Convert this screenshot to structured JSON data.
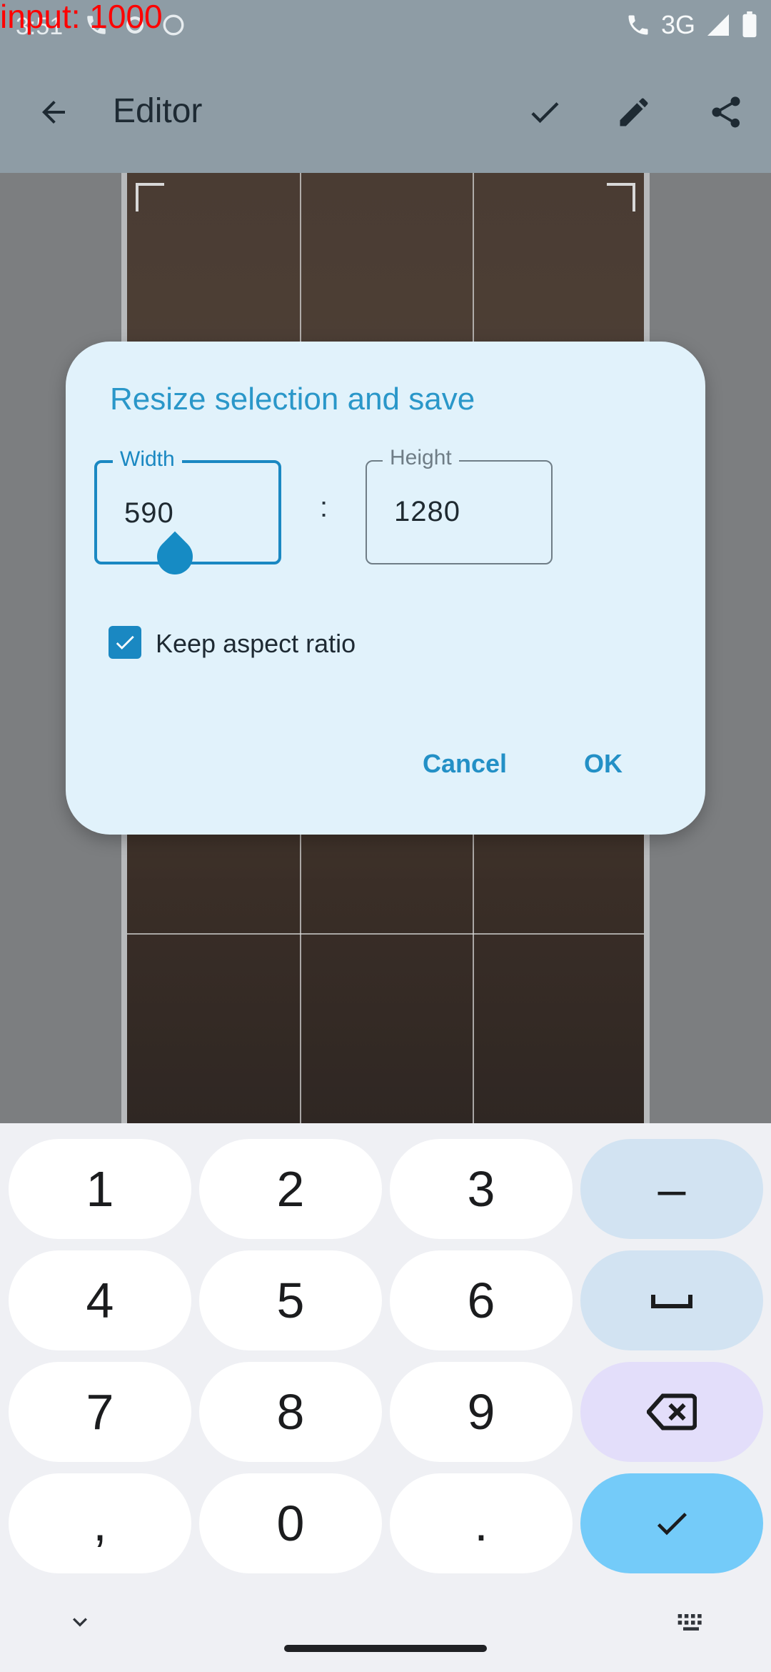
{
  "debug": {
    "input_text": "input: 1000"
  },
  "status": {
    "time": "3:51",
    "network": "3G"
  },
  "app_bar": {
    "title": "Editor",
    "back_icon": "back-arrow-icon",
    "confirm_icon": "check-icon",
    "edit_icon": "pencil-icon",
    "share_icon": "share-icon"
  },
  "dialog": {
    "title": "Resize selection and save",
    "width_label": "Width",
    "width_value": "590",
    "height_label": "Height",
    "height_value": "1280",
    "separator": ":",
    "keep_aspect_ratio_label": "Keep aspect ratio",
    "keep_aspect_ratio_checked": true,
    "cancel_label": "Cancel",
    "ok_label": "OK"
  },
  "keyboard": {
    "keys": [
      "1",
      "2",
      "3",
      "–",
      "4",
      "5",
      "6",
      "space",
      "7",
      "8",
      "9",
      "backspace",
      ",",
      "0",
      ".",
      "done"
    ],
    "k1": "1",
    "k2": "2",
    "k3": "3",
    "kminus": "–",
    "k4": "4",
    "k5": "5",
    "k6": "6",
    "k7": "7",
    "k8": "8",
    "k9": "9",
    "kcomma": ",",
    "k0": "0",
    "kdot": "."
  },
  "colors": {
    "accent": "#1a88c2",
    "dialog_bg": "#e1f2fb",
    "confirm_key": "#74cbf9"
  }
}
